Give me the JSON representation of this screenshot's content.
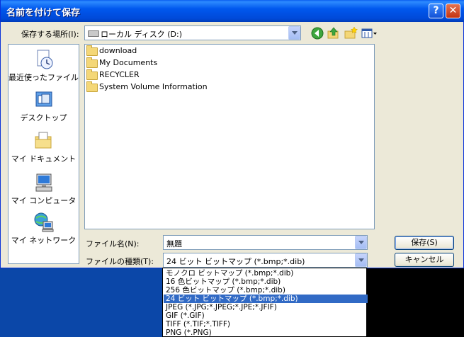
{
  "window": {
    "title": "名前を付けて保存"
  },
  "titlebar_buttons": {
    "help": "?",
    "close": "✕"
  },
  "location": {
    "label": "保存する場所(I):",
    "value": "ローカル ディスク (D:)"
  },
  "places": [
    {
      "label": "最近使ったファイル",
      "icon": "recent-documents-icon"
    },
    {
      "label": "デスクトップ",
      "icon": "desktop-icon"
    },
    {
      "label": "マイ ドキュメント",
      "icon": "my-documents-icon"
    },
    {
      "label": "マイ コンピュータ",
      "icon": "my-computer-icon"
    },
    {
      "label": "マイ ネットワーク",
      "icon": "my-network-icon"
    }
  ],
  "files": [
    {
      "name": "download"
    },
    {
      "name": "My Documents"
    },
    {
      "name": "RECYCLER"
    },
    {
      "name": "System Volume Information"
    }
  ],
  "filename": {
    "label": "ファイル名(N):",
    "value": "無題"
  },
  "filetype": {
    "label": "ファイルの種類(T):",
    "value": "24 ビット ビットマップ (*.bmp;*.dib)"
  },
  "buttons": {
    "save": "保存(S)",
    "cancel": "キャンセル"
  },
  "filetype_options": [
    "モノクロ ビットマップ (*.bmp;*.dib)",
    "16 色ビットマップ (*.bmp;*.dib)",
    "256 色ビットマップ (*.bmp;*.dib)",
    "24 ビット ビットマップ (*.bmp;*.dib)",
    "JPEG (*.JPG;*.JPEG;*.JPE;*.JFIF)",
    "GIF (*.GIF)",
    "TIFF (*.TIF;*.TIFF)",
    "PNG (*.PNG)"
  ],
  "selected_filetype_index": 3,
  "colors": {
    "titlebar": "#0058ee",
    "selection": "#316ac5",
    "dialog_bg": "#ece9d8"
  }
}
